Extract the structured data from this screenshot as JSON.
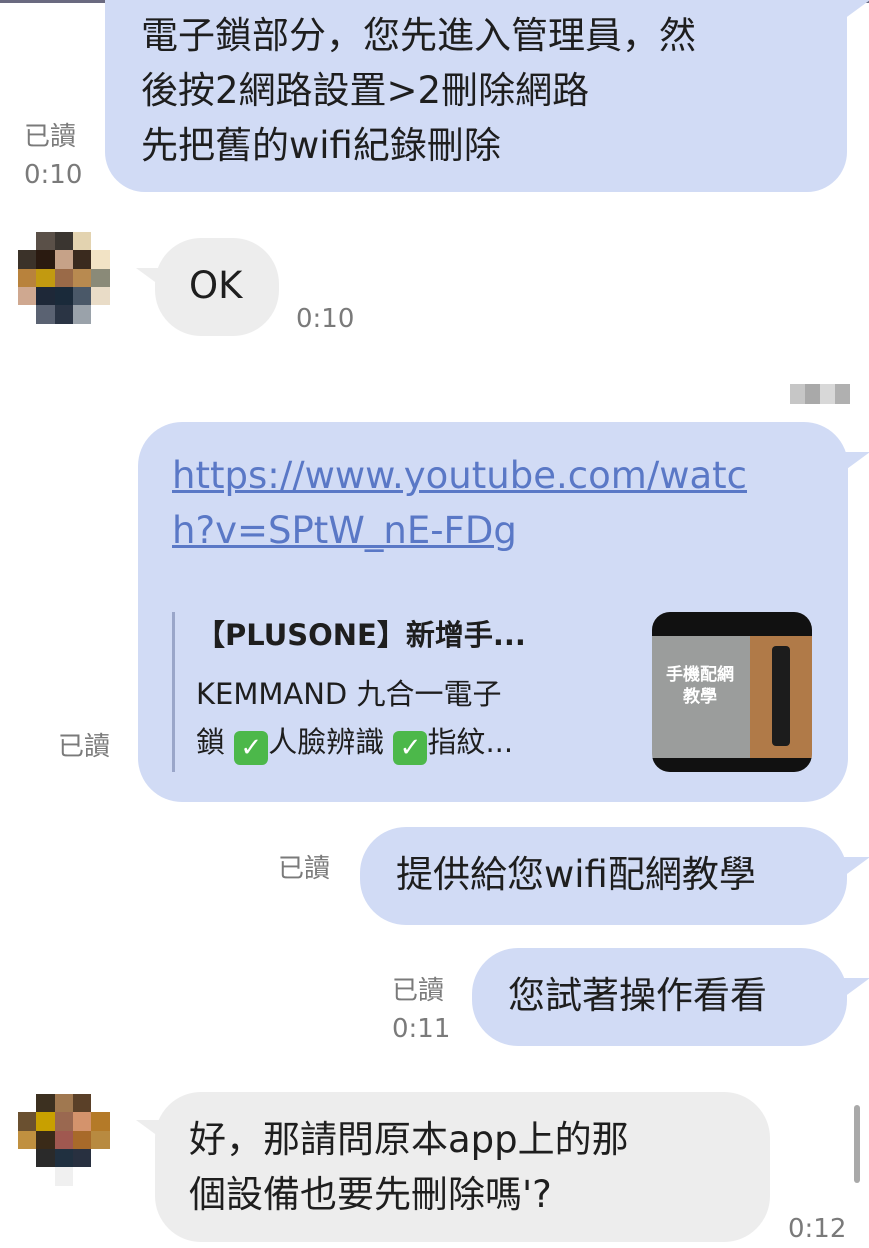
{
  "chat": {
    "messages": [
      {
        "side": "out",
        "text": "電子鎖部分，您先進入管理員，然\n後按2網路設置>2刪除網路\n先把舊的wifi紀錄刪除",
        "read": "已讀",
        "time": "0:10"
      },
      {
        "side": "in",
        "text": "OK",
        "time": "0:10"
      },
      {
        "side": "out",
        "type": "link",
        "url_line1": "https://www.youtube.com/watc",
        "url_line2": "h?v=SPtW_nE-FDg",
        "read": "已讀",
        "preview": {
          "title": "【PLUSONE】新增手...",
          "desc_a": "KEMMAND 九合一電子",
          "desc_b": "鎖",
          "desc_c": "人臉辨識",
          "desc_d": "指紋...",
          "thumb_caption_1": "手機配網",
          "thumb_caption_2": "教學"
        }
      },
      {
        "side": "out",
        "text": "提供給您wifi配網教學",
        "read": "已讀"
      },
      {
        "side": "out",
        "text": "您試著操作看看",
        "read": "已讀",
        "time": "0:11"
      },
      {
        "side": "in",
        "text": "好，那請問原本app上的那\n個設備也要先刪除嗎'?",
        "time": "0:12"
      }
    ],
    "icons": {
      "check": "check-mark-icon"
    }
  }
}
